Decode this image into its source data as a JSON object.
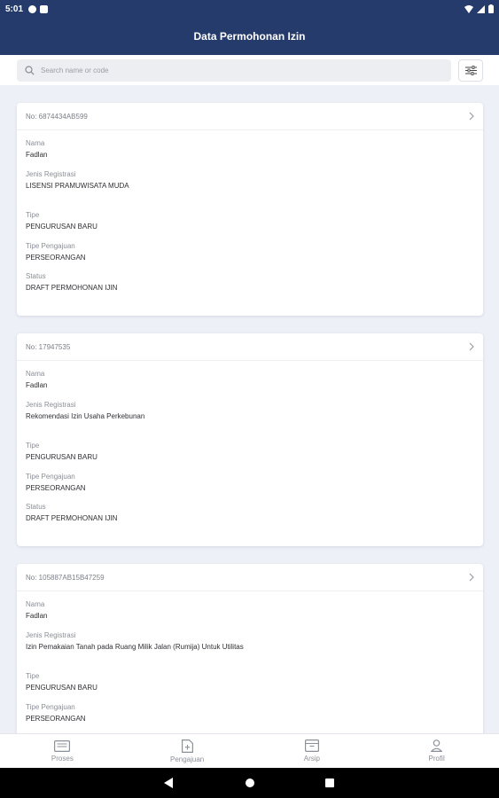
{
  "status_bar": {
    "time": "5:01"
  },
  "app_bar": {
    "title": "Data Permohonan Izin"
  },
  "search": {
    "placeholder": "Search name or code"
  },
  "cards": [
    {
      "number": "No: 6874434AB599",
      "nama_label": "Nama",
      "nama": "Fadlan",
      "jenis_label": "Jenis Registrasi",
      "jenis": "LISENSI PRAMUWISATA MUDA",
      "tipe_label": "Tipe",
      "tipe": "PENGURUSAN BARU",
      "pengajuan_label": "Tipe Pengajuan",
      "pengajuan": "PERSEORANGAN",
      "status_label": "Status",
      "status": "DRAFT PERMOHONAN IJIN"
    },
    {
      "number": "No: 17947535",
      "nama_label": "Nama",
      "nama": "Fadlan",
      "jenis_label": "Jenis Registrasi",
      "jenis": "Rekomendasi Izin Usaha Perkebunan",
      "tipe_label": "Tipe",
      "tipe": "PENGURUSAN BARU",
      "pengajuan_label": "Tipe Pengajuan",
      "pengajuan": "PERSEORANGAN",
      "status_label": "Status",
      "status": "DRAFT PERMOHONAN IJIN"
    },
    {
      "number": "No: 105887AB15B47259",
      "nama_label": "Nama",
      "nama": "Fadlan",
      "jenis_label": "Jenis Registrasi",
      "jenis": "Izin Pemakaian Tanah pada Ruang Milik Jalan (Rumija) Untuk Utilitas",
      "tipe_label": "Tipe",
      "tipe": "PENGURUSAN BARU",
      "pengajuan_label": "Tipe Pengajuan",
      "pengajuan": "PERSEORANGAN"
    }
  ],
  "bottom_nav": {
    "items": [
      {
        "label": "Proses",
        "icon": "inbox-icon"
      },
      {
        "label": "Pengajuan",
        "icon": "file-add-icon"
      },
      {
        "label": "Arsip",
        "icon": "archive-icon"
      },
      {
        "label": "Profil",
        "icon": "user-icon"
      }
    ]
  },
  "colors": {
    "primary": "#243b6b",
    "background": "#eef0f8"
  }
}
